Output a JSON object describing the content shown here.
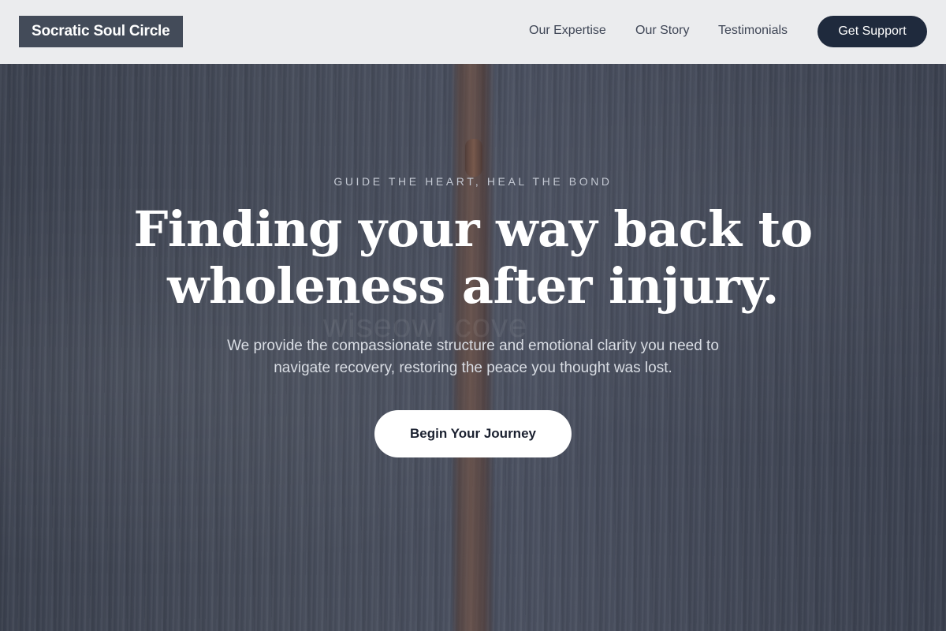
{
  "brand": {
    "name": "Socratic Soul Circle"
  },
  "nav": {
    "links": [
      {
        "label": "Our Expertise"
      },
      {
        "label": "Our Story"
      },
      {
        "label": "Testimonials"
      }
    ],
    "cta_label": "Get Support"
  },
  "hero": {
    "eyebrow": "GUIDE THE HEART, HEAL THE BOND",
    "headline_line1": "Finding your way back to",
    "headline_line2": "wholeness after injury.",
    "subtext": "We provide the compassionate structure and emotional clarity you need to navigate recovery, restoring the peace you thought was lost.",
    "cta_label": "Begin Your Journey",
    "watermark": "wiseowl cove"
  },
  "colors": {
    "nav_background": "#ebecee",
    "logo_background": "#434b59",
    "nav_cta_background": "#1f2a3d",
    "hero_overlay": "#3a404c",
    "hero_cta_background": "#ffffff"
  }
}
